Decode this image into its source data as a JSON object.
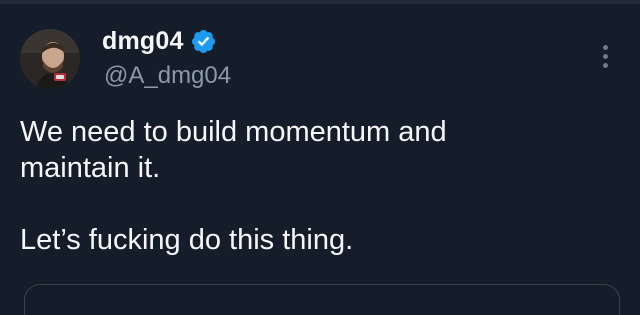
{
  "author": {
    "display_name": "dmg04",
    "handle": "@A_dmg04",
    "verified": true,
    "verified_color": "#1d9bf0",
    "avatar_icon": "profile-photo"
  },
  "menu": {
    "icon": "more-vertical-icon"
  },
  "tweet": {
    "line1": "We need to build momentum and",
    "line2": "maintain it.",
    "line3": "Let’s fucking do this thing."
  },
  "theme": {
    "background": "#151d2a",
    "text": "#f4f6f8",
    "muted": "#8b98a5"
  }
}
